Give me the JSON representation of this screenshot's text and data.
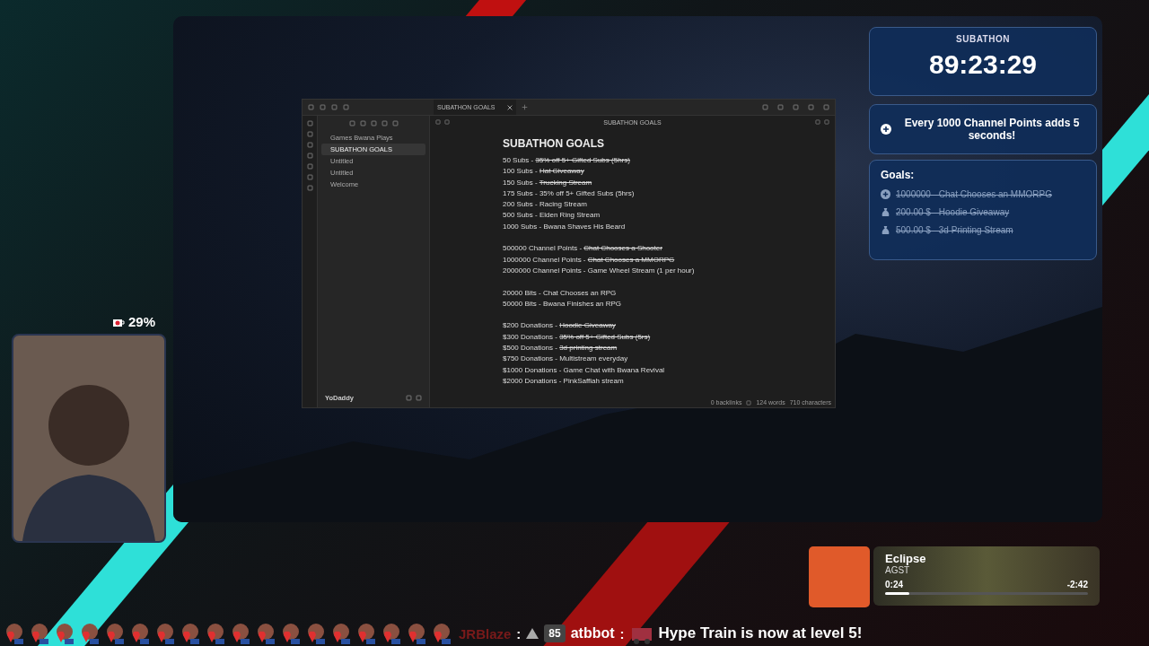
{
  "notes_window": {
    "tab_title": "SUBATHON GOALS",
    "header_title": "SUBATHON GOALS",
    "files": [
      {
        "name": "Games Bwana Plays",
        "selected": false
      },
      {
        "name": "SUBATHON GOALS",
        "selected": true
      },
      {
        "name": "Untitled",
        "selected": false
      },
      {
        "name": "Untitled",
        "selected": false
      },
      {
        "name": "Welcome",
        "selected": false
      }
    ],
    "user": "YoDaddy",
    "heading": "SUBATHON GOALS",
    "sections": [
      {
        "lines": [
          {
            "prefix": "50 Subs - ",
            "goal": "35% off 5+ Gifted Subs (5hrs)",
            "done": true
          },
          {
            "prefix": "100 Subs - ",
            "goal": "Hat Giveaway",
            "done": true
          },
          {
            "prefix": "150 Subs - ",
            "goal": "Trucking Stream",
            "done": true
          },
          {
            "prefix": "175 Subs - ",
            "goal": "35% off 5+ Gifted Subs (5hrs)",
            "done": false
          },
          {
            "prefix": "200 Subs - ",
            "goal": "Racing Stream",
            "done": false
          },
          {
            "prefix": "500 Subs - ",
            "goal": "Elden Ring Stream",
            "done": false
          },
          {
            "prefix": "1000 Subs - ",
            "goal": "Bwana Shaves His Beard",
            "done": false
          }
        ]
      },
      {
        "lines": [
          {
            "prefix": "500000 Channel Points - ",
            "goal": "Chat Chooses a Shooter",
            "done": true
          },
          {
            "prefix": "1000000 Channel Points - ",
            "goal": "Chat Chooses a MMORPG",
            "done": true
          },
          {
            "prefix": "2000000 Channel Points - ",
            "goal": "Game Wheel Stream (1 per hour)",
            "done": false
          }
        ]
      },
      {
        "lines": [
          {
            "prefix": "20000 Bits - ",
            "goal": "Chat Chooses an RPG",
            "done": false
          },
          {
            "prefix": "50000 Bits - ",
            "goal": "Bwana Finishes an RPG",
            "done": false
          }
        ]
      },
      {
        "lines": [
          {
            "prefix": "$200 Donations - ",
            "goal": "Hoodie Giveaway",
            "done": true
          },
          {
            "prefix": "$300 Donations - ",
            "goal": "35% off 5+ Gifted Subs (5rs)",
            "done": true
          },
          {
            "prefix": "$500 Donations - ",
            "goal": "3d printing stream",
            "done": true
          },
          {
            "prefix": "$750 Donations - ",
            "goal": "Multistream everyday",
            "done": false
          },
          {
            "prefix": "$1000 Donations - ",
            "goal": "Game Chat with Bwana Revival",
            "done": false
          },
          {
            "prefix": "$2000 Donations - ",
            "goal": "PinkSaffiah stream",
            "done": false
          }
        ]
      }
    ],
    "status": {
      "backlinks": "0 backlinks",
      "words": "124 words",
      "characters": "710 characters"
    }
  },
  "subathon": {
    "label": "SUBATHON",
    "timer": "89:23:29",
    "rule": "Every 1000 Channel Points adds 5 seconds!",
    "goals_title": "Goals:",
    "goals": [
      {
        "kind": "points",
        "text": "1000000 - Chat Chooses an MMORPG",
        "done": true
      },
      {
        "kind": "money",
        "text": "200.00 $ - Hoodie Giveaway",
        "done": true
      },
      {
        "kind": "money",
        "text": "500.00 $ - 3d Printing Stream",
        "done": true
      }
    ]
  },
  "webcam": {
    "meter": "29%"
  },
  "now_playing": {
    "title": "Eclipse",
    "artist": "AGST",
    "elapsed": "0:24",
    "remaining": "-2:42",
    "level": 0.12
  },
  "chat_ticker": {
    "messages": [
      {
        "user": "JRBlaze",
        "separator": ":",
        "badge": "85"
      },
      {
        "user": "atbbot",
        "separator": ":",
        "text": "Hype Train is now at level 5!"
      }
    ]
  }
}
